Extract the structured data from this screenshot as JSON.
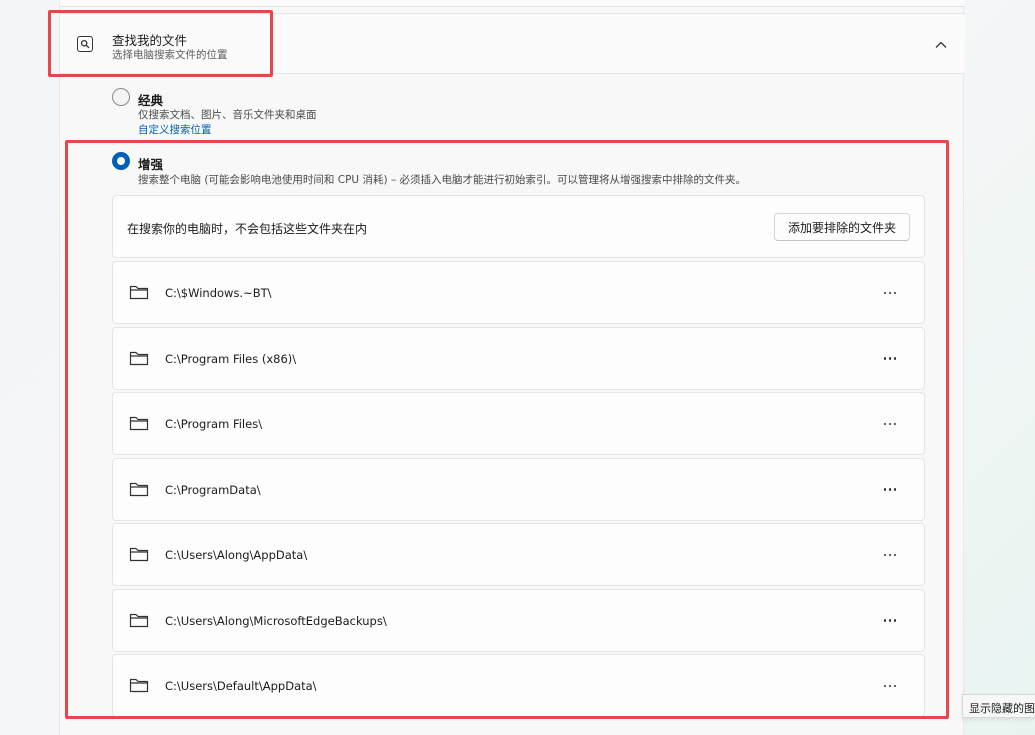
{
  "section": {
    "title": "查找我的文件",
    "subtitle": "选择电脑搜索文件的位置",
    "icon": "search-files-icon"
  },
  "options": {
    "classic": {
      "title": "经典",
      "description": "仅搜索文档、图片、音乐文件夹和桌面",
      "link": "自定义搜索位置",
      "selected": false
    },
    "enhanced": {
      "title": "增强",
      "description": "搜索整个电脑 (可能会影响电池使用时间和 CPU 消耗) – 必须插入电脑才能进行初始索引。可以管理将从增强搜索中排除的文件夹。",
      "selected": true
    }
  },
  "exclusions": {
    "header_text": "在搜索你的电脑时，不会包括这些文件夹在内",
    "add_button": "添加要排除的文件夹",
    "folders": [
      "C:\\$Windows.~BT\\",
      "C:\\Program Files (x86)\\",
      "C:\\Program Files\\",
      "C:\\ProgramData\\",
      "C:\\Users\\Along\\AppData\\",
      "C:\\Users\\Along\\MicrosoftEdgeBackups\\",
      "C:\\Users\\Default\\AppData\\"
    ]
  },
  "tooltip": "显示隐藏的图",
  "colors": {
    "accent": "#005fb8",
    "highlight": "#e8474a"
  }
}
